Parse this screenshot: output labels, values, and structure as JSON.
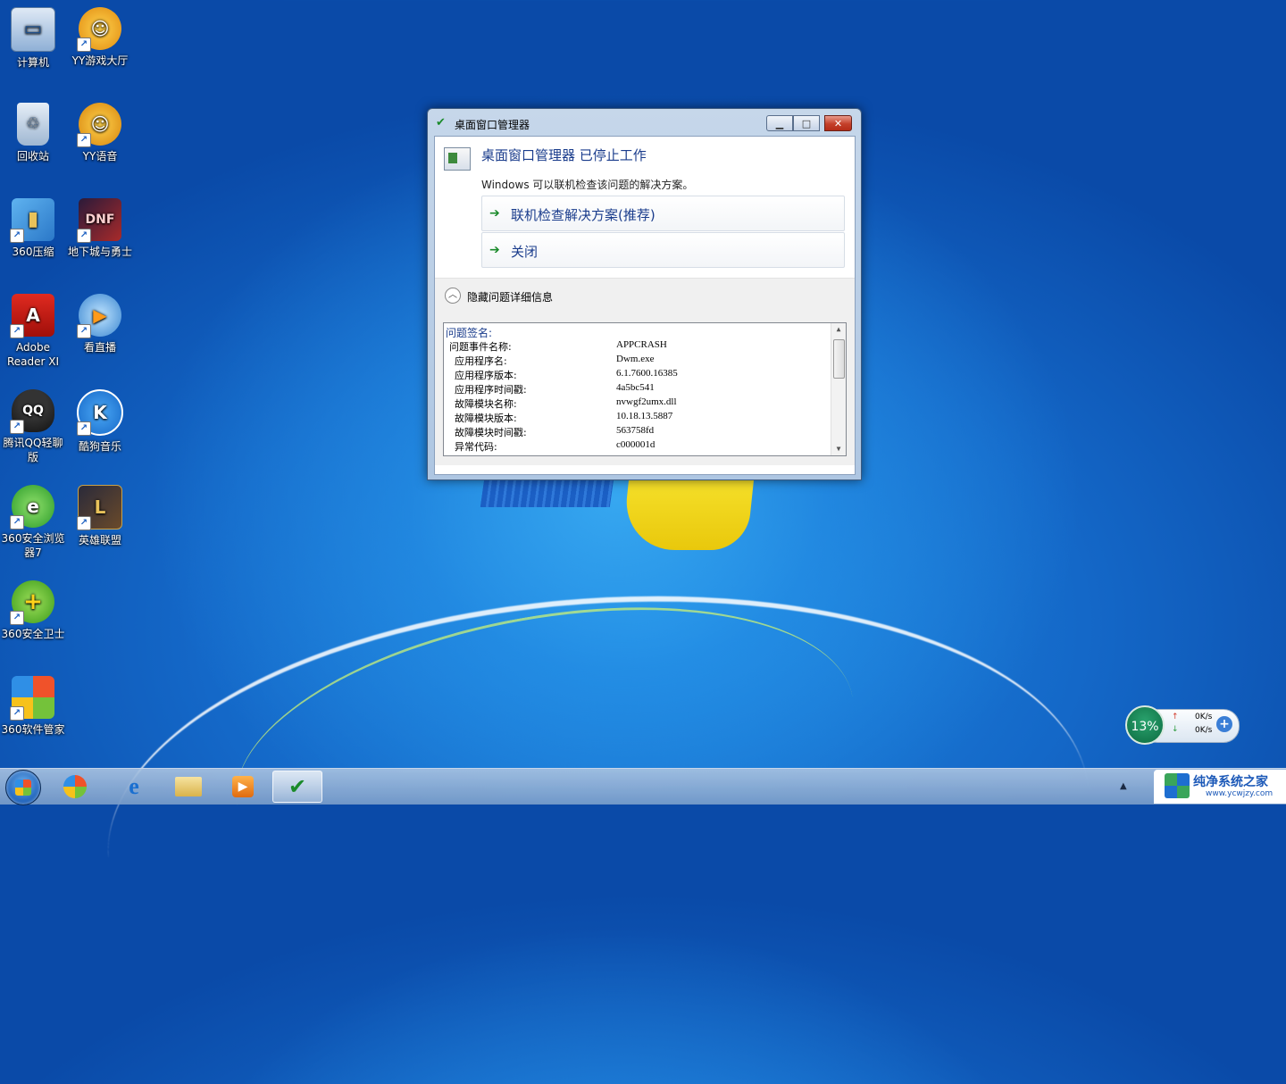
{
  "desktop": {
    "icons": [
      {
        "label": "计算机",
        "icon": "computer-icon"
      },
      {
        "label": "YY游戏大厅",
        "icon": "yy-game-icon"
      },
      {
        "label": "回收站",
        "icon": "recycle-bin-icon"
      },
      {
        "label": "YY语音",
        "icon": "yy-voice-icon"
      },
      {
        "label": "360压缩",
        "icon": "archive-icon"
      },
      {
        "label": "地下城与勇士",
        "icon": "dnf-icon"
      },
      {
        "label": "Adobe Reader XI",
        "icon": "adobe-reader-icon"
      },
      {
        "label": "看直播",
        "icon": "live-stream-icon"
      },
      {
        "label": "腾讯QQ轻聊版",
        "icon": "qq-icon"
      },
      {
        "label": "酷狗音乐",
        "icon": "kugou-icon"
      },
      {
        "label": "360安全浏览器7",
        "icon": "browser-360-icon"
      },
      {
        "label": "英雄联盟",
        "icon": "lol-icon"
      },
      {
        "label": "360安全卫士",
        "icon": "security-360-icon"
      },
      {
        "label": "360软件管家",
        "icon": "software-manager-icon"
      }
    ]
  },
  "dialog": {
    "window_title": "桌面窗口管理器",
    "heading": "桌面窗口管理器 已停止工作",
    "description": "Windows 可以联机检查该问题的解决方案。",
    "commands": [
      {
        "label": "联机检查解决方案(推荐)"
      },
      {
        "label": "关闭"
      }
    ],
    "details_toggle_label": "隐藏问题详细信息",
    "details": {
      "signature_title": "问题签名:",
      "rows": [
        {
          "key": "问题事件名称:",
          "value": "APPCRASH"
        },
        {
          "key": "应用程序名:",
          "value": "Dwm.exe"
        },
        {
          "key": "应用程序版本:",
          "value": "6.1.7600.16385"
        },
        {
          "key": "应用程序时间戳:",
          "value": "4a5bc541"
        },
        {
          "key": "故障模块名称:",
          "value": "nvwgf2umx.dll"
        },
        {
          "key": "故障模块版本:",
          "value": "10.18.13.5887"
        },
        {
          "key": "故障模块时间戳:",
          "value": "563758fd"
        },
        {
          "key": "异常代码:",
          "value": "c000001d"
        }
      ]
    }
  },
  "network_widget": {
    "percent": "13%",
    "upload": "0K/s",
    "download": "0K/s"
  },
  "watermark": {
    "title": "纯净系统之家",
    "url": "www.ycwjzy.com"
  }
}
